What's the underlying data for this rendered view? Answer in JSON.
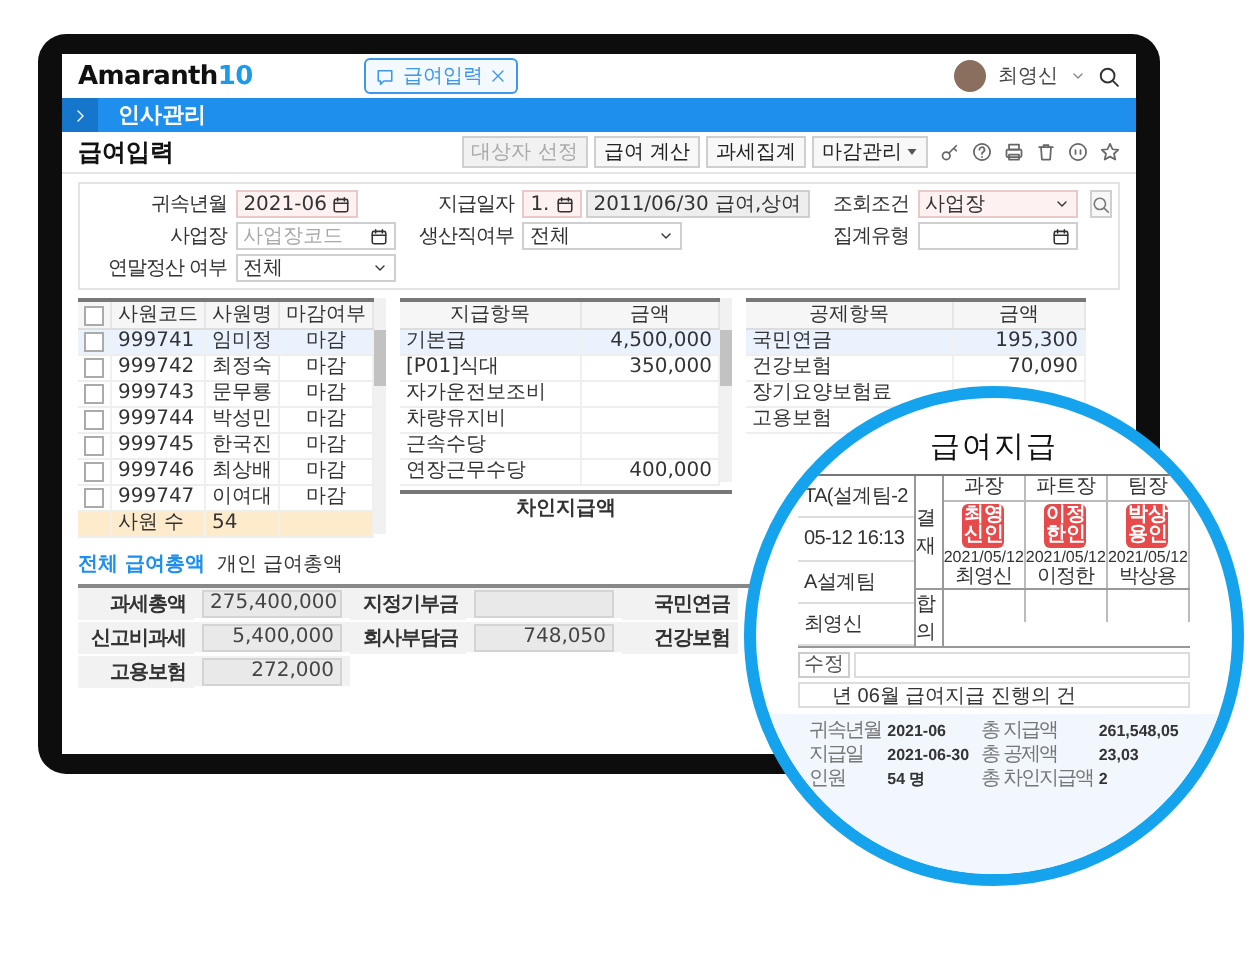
{
  "header": {
    "logo": "Amaranth",
    "logo_version": "10",
    "open_tab": {
      "label": "급여입력",
      "selected": true
    },
    "user": "최영신"
  },
  "menu_bar": {
    "title": "인사관리"
  },
  "page": {
    "title": "급여입력",
    "toolbar": [
      {
        "label": "대상자 선정",
        "kind": "button",
        "disabled": true
      },
      {
        "label": "급여 계산",
        "kind": "button",
        "disabled": false
      },
      {
        "label": "과세집계",
        "kind": "button",
        "disabled": false
      },
      {
        "label": "마감관리",
        "kind": "dropdown",
        "disabled": false
      }
    ]
  },
  "filters": [
    {
      "label": "귀속년월",
      "kind": "date",
      "value": "2021-06",
      "required": true
    },
    {
      "label": "지급일자",
      "kind": "pay_date",
      "number": "1.",
      "value": "2011/06/30 급여,상여",
      "required": true
    },
    {
      "label": "조회조건",
      "kind": "select",
      "value": "사업장",
      "required": true
    },
    {
      "label": "사업장",
      "kind": "code",
      "placeholder": "사업장코드",
      "required": false
    },
    {
      "label": "생산직여부",
      "kind": "select",
      "value": "전체",
      "required": false
    },
    {
      "label": "집계유형",
      "kind": "code",
      "required": false
    },
    {
      "label": "연말정산 여부",
      "kind": "select",
      "value": "전체",
      "required": false
    }
  ],
  "employees": {
    "all_checked": false,
    "columns": [
      "사원코드",
      "사원명",
      "마감여부"
    ],
    "rows": [
      {
        "code": "999741",
        "name": "임미정",
        "status": "마감",
        "checked": false,
        "selected": true
      },
      {
        "code": "999742",
        "name": "최정숙",
        "status": "마감",
        "checked": false,
        "selected": false
      },
      {
        "code": "999743",
        "name": "문무룡",
        "status": "마감",
        "checked": false,
        "selected": false
      },
      {
        "code": "999744",
        "name": "박성민",
        "status": "마감",
        "checked": false,
        "selected": false
      },
      {
        "code": "999745",
        "name": "한국진",
        "status": "마감",
        "checked": false,
        "selected": false
      },
      {
        "code": "999746",
        "name": "최상배",
        "status": "마감",
        "checked": false,
        "selected": false
      },
      {
        "code": "999747",
        "name": "이여대",
        "status": "마감",
        "checked": false,
        "selected": false
      }
    ],
    "footer": {
      "label": "사원 수",
      "value": "54"
    }
  },
  "payments": {
    "columns": [
      "지급항목",
      "금액"
    ],
    "rows": [
      {
        "item": "기본급",
        "amount": "4,500,000",
        "selected": true
      },
      {
        "item": "[P01]식대",
        "amount": "350,000",
        "selected": false
      },
      {
        "item": "자가운전보조비",
        "selected": false
      },
      {
        "item": "차량유지비",
        "selected": false
      },
      {
        "item": "근속수당",
        "selected": false
      },
      {
        "item": "연장근무수당",
        "amount": "400,000",
        "selected": false
      }
    ],
    "footer": {
      "label": "차인지급액"
    }
  },
  "deductions": {
    "columns": [
      "공제항목",
      "금액"
    ],
    "rows": [
      {
        "item": "국민연금",
        "amount": "195,300",
        "selected": true
      },
      {
        "item": "건강보험",
        "amount": "70,090",
        "selected": false
      },
      {
        "item": "장기요양보험료",
        "selected": false
      },
      {
        "item": "고용보험",
        "selected": false
      }
    ]
  },
  "summary_tabs": [
    {
      "label": "전체 급여총액",
      "selected": true
    },
    {
      "label": "개인 급여총액",
      "selected": false
    }
  ],
  "summary": [
    {
      "label": "과세총액",
      "value": "275,400,000"
    },
    {
      "label": "지정기부금"
    },
    {
      "label": "국민연금"
    },
    {
      "label": "신고비과세",
      "value": "5,400,000"
    },
    {
      "label": "회사부담금",
      "value": "748,050"
    },
    {
      "label": "건강보험"
    },
    {
      "label": "고용보험",
      "value": "272,000"
    }
  ],
  "magnifier": {
    "title": "급여지급",
    "info_rows": [
      "TA(설계팀-2",
      "05-12 16:13",
      "A설계팀",
      "최영신"
    ],
    "approval_label": "결재",
    "steps": [
      {
        "role": "과장",
        "stamp_lines": [
          "최영",
          "신인"
        ],
        "date": "2021/05/12",
        "signer": "최영신"
      },
      {
        "role": "파트장",
        "stamp_lines": [
          "이정",
          "한인"
        ],
        "date": "2021/05/12",
        "signer": "이정한"
      },
      {
        "role": "팀장",
        "stamp_lines": [
          "박상",
          "용인"
        ],
        "date": "2021/05/12",
        "signer": "박상용"
      }
    ],
    "agreement_label": "합의",
    "edit_button": "수정",
    "subject": "년 06월 급여지급 진행의 건",
    "summary_left": [
      {
        "label": "귀속년월",
        "value": "2021-06"
      },
      {
        "label": "지급일",
        "value": "2021-06-30"
      },
      {
        "label": "인원",
        "value": "54 명"
      }
    ],
    "summary_right": [
      {
        "label": "총 지급액",
        "value": "261,548,05"
      },
      {
        "label": "총 공제액",
        "value": "23,03"
      },
      {
        "label": "총 차인지급액",
        "value": "2"
      }
    ]
  }
}
